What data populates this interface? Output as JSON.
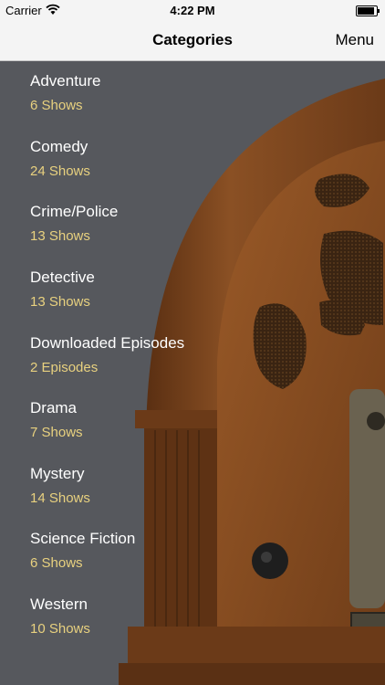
{
  "status_bar": {
    "carrier": "Carrier",
    "time": "4:22 PM",
    "icons": [
      "wifi-icon",
      "battery-icon"
    ]
  },
  "nav": {
    "title": "Categories",
    "menu_label": "Menu"
  },
  "categories": [
    {
      "name": "Adventure",
      "count": "6 Shows"
    },
    {
      "name": "Comedy",
      "count": "24 Shows"
    },
    {
      "name": "Crime/Police",
      "count": "13 Shows"
    },
    {
      "name": "Detective",
      "count": "13 Shows"
    },
    {
      "name": "Downloaded Episodes",
      "count": "2 Episodes"
    },
    {
      "name": "Drama",
      "count": "7 Shows"
    },
    {
      "name": "Mystery",
      "count": "14 Shows"
    },
    {
      "name": "Science Fiction",
      "count": "6 Shows"
    },
    {
      "name": "Western",
      "count": "10 Shows"
    }
  ],
  "colors": {
    "background": "#56585d",
    "title_text": "#ffffff",
    "count_text": "#e8d17f",
    "wood": "#7a4520"
  },
  "background_image": "antique-cathedral-radio"
}
